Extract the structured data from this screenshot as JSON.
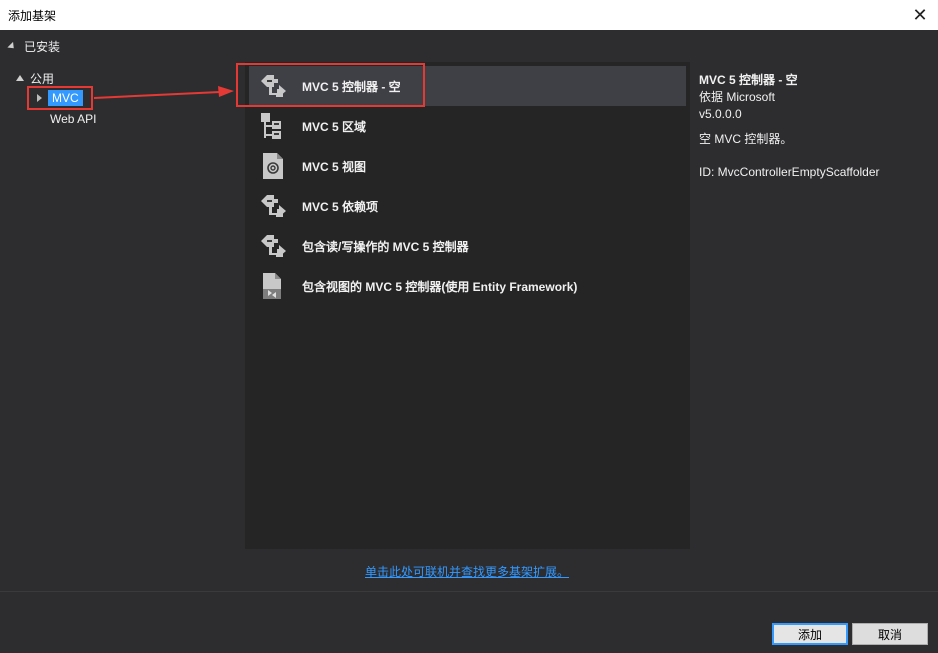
{
  "window": {
    "title": "添加基架",
    "close_glyph": "✕"
  },
  "tree": {
    "installed": "已安装",
    "public": "公用",
    "mvc": "MVC",
    "webapi": "Web API"
  },
  "items": [
    {
      "label": "MVC 5 控制器 - 空",
      "icon": "controller-icon"
    },
    {
      "label": "MVC 5 区域",
      "icon": "area-icon"
    },
    {
      "label": "MVC 5 视图",
      "icon": "view-icon"
    },
    {
      "label": "MVC 5 依赖项",
      "icon": "dependency-icon"
    },
    {
      "label": "包含读/写操作的 MVC 5 控制器",
      "icon": "controller-icon"
    },
    {
      "label": "包含视图的 MVC 5 控制器(使用 Entity Framework)",
      "icon": "controller-views-icon"
    }
  ],
  "details": {
    "name": "MVC 5 控制器 - 空",
    "publisher": "依据 Microsoft",
    "version": "v5.0.0.0",
    "description": "空 MVC 控制器。",
    "id": "ID: MvcControllerEmptyScaffolder"
  },
  "online_link": "单击此处可联机并查找更多基架扩展。",
  "buttons": {
    "add": "添加",
    "cancel": "取消"
  },
  "colors": {
    "accent": "#3399ff",
    "highlight": "#e53935",
    "background": "#2d2d30",
    "list_bg": "#252526",
    "selected": "#3f3f46"
  }
}
